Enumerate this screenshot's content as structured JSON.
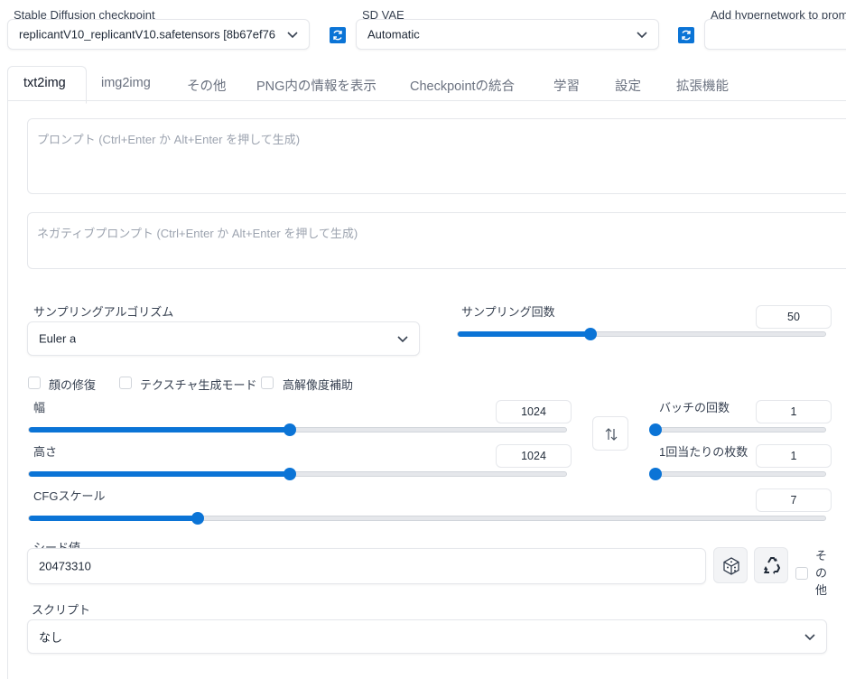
{
  "header": {
    "checkpoint_label": "Stable Diffusion checkpoint",
    "checkpoint_value": "replicantV10_replicantV10.safetensors [8b67ef76",
    "vae_label": "SD VAE",
    "vae_value": "Automatic",
    "hypernetwork_label": "Add hypernetwork to prom"
  },
  "tabs": [
    {
      "label": "txt2img"
    },
    {
      "label": "img2img"
    },
    {
      "label": "その他"
    },
    {
      "label": "PNG内の情報を表示"
    },
    {
      "label": "Checkpointの統合"
    },
    {
      "label": "学習"
    },
    {
      "label": "設定"
    },
    {
      "label": "拡張機能"
    }
  ],
  "prompt": {
    "placeholder": "プロンプト (Ctrl+Enter か Alt+Enter を押して生成)"
  },
  "negative_prompt": {
    "placeholder": "ネガティブプロンプト (Ctrl+Enter か Alt+Enter を押して生成)"
  },
  "sampling": {
    "method_label": "サンプリングアルゴリズム",
    "method_value": "Euler a",
    "steps_label": "サンプリング回数",
    "steps_value": "50",
    "steps_fraction": 0.36
  },
  "options": {
    "face_restore": "顔の修復",
    "tiling": "テクスチャ生成モード",
    "hires_fix": "高解像度補助"
  },
  "size": {
    "width_label": "幅",
    "width_value": "1024",
    "width_fraction": 0.486,
    "height_label": "高さ",
    "height_value": "1024",
    "height_fraction": 0.486,
    "swap_icon": "swap-vertical-icon"
  },
  "batch": {
    "count_label": "バッチの回数",
    "count_value": "1",
    "count_fraction": 0.0,
    "size_label": "1回当たりの枚数",
    "size_value": "1",
    "size_fraction": 0.0
  },
  "cfg": {
    "label": "CFGスケール",
    "value": "7",
    "fraction": 0.212
  },
  "seed": {
    "label": "シード値",
    "value": "20473310",
    "extra_label": "その他"
  },
  "script": {
    "label": "スクリプト",
    "value": "なし"
  },
  "colors": {
    "accent": "#0b74d6",
    "border": "#e5e7eb"
  }
}
